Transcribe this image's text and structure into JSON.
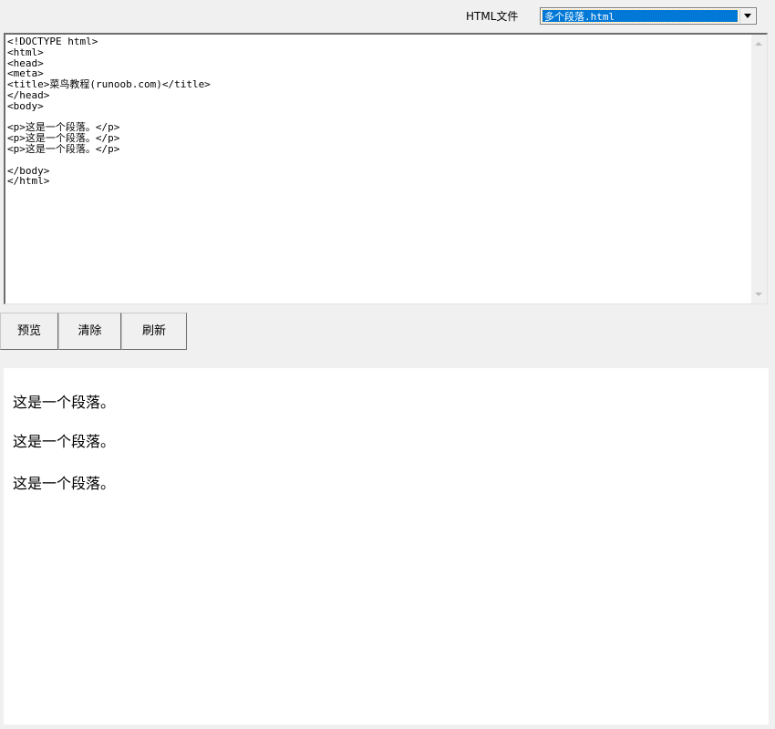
{
  "toolbar": {
    "file_label": "HTML文件",
    "selected_file": "多个段落.html",
    "dropdown_icon": "chevron-down-icon"
  },
  "editor": {
    "code": "<!DOCTYPE html>\n<html>\n<head>\n<meta>\n<title>菜鸟教程(runoob.com)</title>\n</head>\n<body>\n\n<p>这是一个段落。</p>\n<p>这是一个段落。</p>\n<p>这是一个段落。</p>\n\n</body>\n</html>"
  },
  "buttons": {
    "preview": "预览",
    "clear": "清除",
    "refresh": "刷新"
  },
  "preview": {
    "paragraphs": [
      "这是一个段落。",
      "这是一个段落。",
      "这是一个段落。"
    ]
  }
}
